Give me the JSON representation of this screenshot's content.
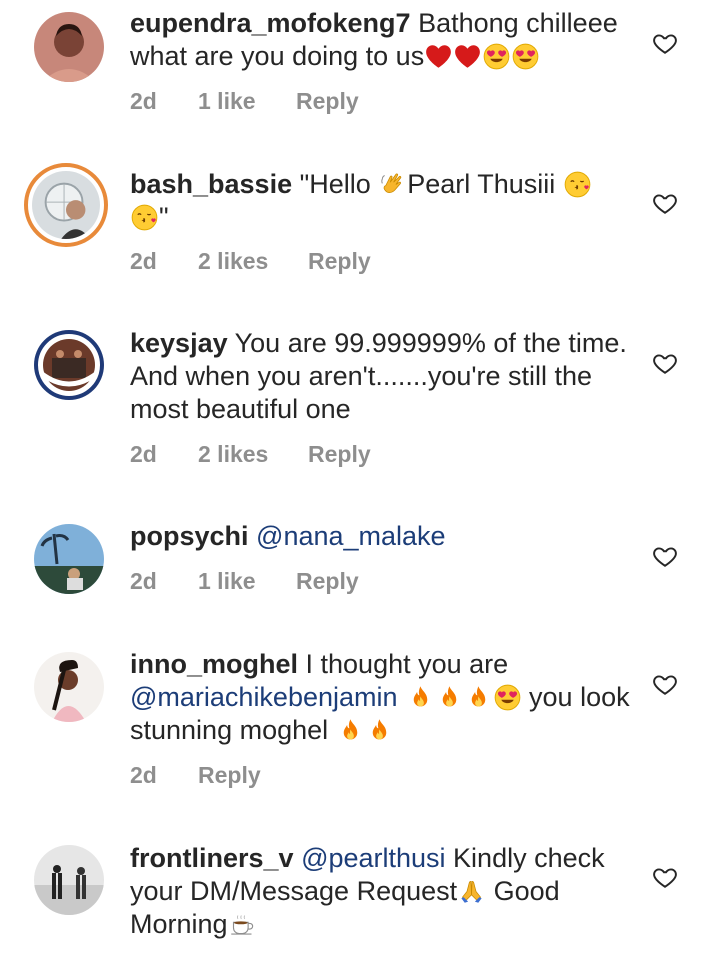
{
  "comments": [
    {
      "username": "eupendra_mofokeng7",
      "text": "Bathong chilleee what are you doing to us",
      "time": "2d",
      "likes": "1 like",
      "reply": "Reply"
    },
    {
      "username": "bash_bassie",
      "text_a": "\"Hello ",
      "text_b": "Pearl Thusiii ",
      "text_c": "\"",
      "time": "2d",
      "likes": "2 likes",
      "reply": "Reply"
    },
    {
      "username": "keysjay",
      "text": "You are 99.999999% of the time. And when you aren't.......you're still the most beautiful one",
      "time": "2d",
      "likes": "2 likes",
      "reply": "Reply"
    },
    {
      "username": "popsychi",
      "mention": "@nana_malake",
      "time": "2d",
      "likes": "1 like",
      "reply": "Reply"
    },
    {
      "username": "inno_moghel",
      "text_a": "I thought you are ",
      "mention": "@mariachikebenjamin",
      "text_b": " you look stunning moghel ",
      "time": "2d",
      "reply": "Reply"
    },
    {
      "username": "frontliners_v",
      "mention": "@pearlthusi",
      "text_a": " Kindly check your DM/Message Request",
      "text_b": " Good Morning"
    }
  ],
  "icons": {
    "like": "heart-outline-icon",
    "red_heart": "red-heart-emoji",
    "heart_eyes": "heart-eyes-emoji",
    "wave": "waving-hand-emoji",
    "kiss": "kissing-face-emoji",
    "fire": "fire-emoji",
    "pray": "folded-hands-emoji",
    "coffee": "hot-beverage-emoji"
  },
  "colors": {
    "mention": "#1c3d78",
    "meta": "#8e8e8e",
    "text": "#262626",
    "story_ring": "#e88a3a"
  }
}
